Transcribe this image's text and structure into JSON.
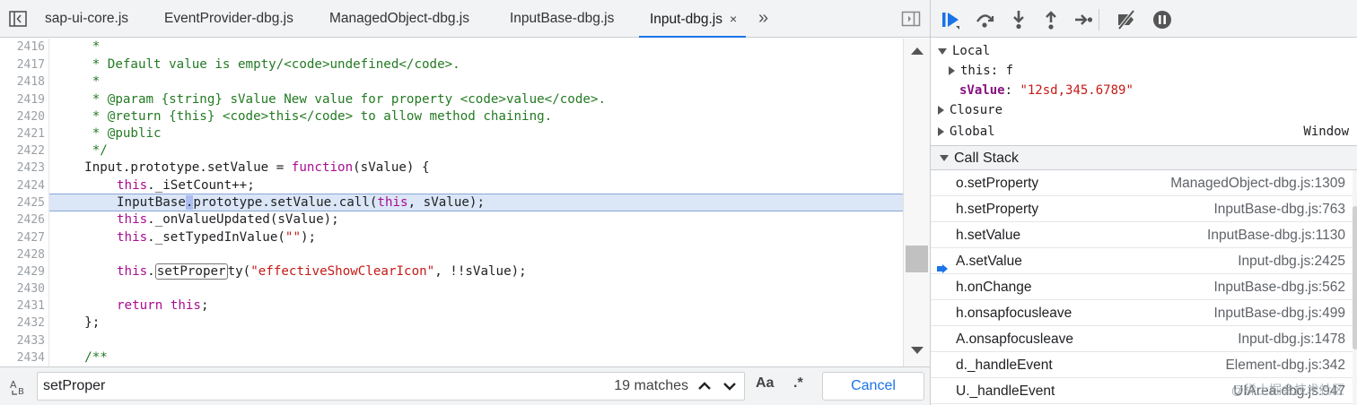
{
  "tabs": [
    {
      "label": "sap-ui-core.js",
      "active": false
    },
    {
      "label": "EventProvider-dbg.js",
      "active": false
    },
    {
      "label": "ManagedObject-dbg.js",
      "active": false
    },
    {
      "label": "InputBase-dbg.js",
      "active": false
    },
    {
      "label": "Input-dbg.js",
      "active": true
    }
  ],
  "tab_close_glyph": "×",
  "tab_more_glyph": "»",
  "code": {
    "lines": [
      {
        "n": "2416"
      },
      {
        "n": "2417"
      },
      {
        "n": "2418"
      },
      {
        "n": "2419"
      },
      {
        "n": "2420"
      },
      {
        "n": "2421"
      },
      {
        "n": "2422"
      },
      {
        "n": "2423"
      },
      {
        "n": "2424"
      },
      {
        "n": "2425"
      },
      {
        "n": "2426"
      },
      {
        "n": "2427"
      },
      {
        "n": "2428"
      },
      {
        "n": "2429"
      },
      {
        "n": "2430"
      },
      {
        "n": "2431"
      },
      {
        "n": "2432"
      },
      {
        "n": "2433"
      },
      {
        "n": "2434"
      }
    ],
    "t2416": "     *",
    "t2417": "     * Default value is empty/<code>undefined</code>.",
    "t2418": "     *",
    "t2419": "     * @param {string} sValue New value for property <code>value</code>.",
    "t2420": "     * @return {this} <code>this</code> to allow method chaining.",
    "t2421": "     * @public",
    "t2422": "     */",
    "t2423a": "    Input.prototype.setValue = ",
    "t2423b": "function",
    "t2423c": "(sValue) {",
    "t2424a": "this",
    "t2424b": "._iSetCount++;",
    "t2425a": "InputBase",
    "t2425b": ".",
    "t2425c": "prototype.setValue.call(",
    "t2425d": "this",
    "t2425e": ", sValue);",
    "t2426a": "this",
    "t2426b": "._onValueUpdated(sValue);",
    "t2427a": "this",
    "t2427b": "._setTypedInValue(",
    "t2427c": "\"\"",
    "t2427d": ");",
    "t2429a": "this",
    "t2429b": ".",
    "t2429c": "setProper",
    "t2429d": "ty(",
    "t2429e": "\"effectiveShowClearIcon\"",
    "t2429f": ", !!sValue);",
    "t2431a": "return",
    "t2431b": " ",
    "t2431c": "this",
    "t2431d": ";",
    "t2432": "    };",
    "t2434": "    /**"
  },
  "search": {
    "value": "setProper",
    "match_count": "19 matches",
    "case_label": "Aa",
    "regex_label": ".*",
    "cancel_label": "Cancel"
  },
  "scope": {
    "local_label": "Local",
    "this_label": "this",
    "this_value": ": f",
    "svalue_label": "sValue",
    "svalue_sep": ": ",
    "svalue_value": "\"12sd,345.6789\"",
    "closure_label": "Closure",
    "global_label": "Global",
    "global_value": "Window"
  },
  "call_stack": {
    "header": "Call Stack",
    "frames": [
      {
        "fn": "o.setProperty",
        "loc": "ManagedObject-dbg.js:1309",
        "current": false
      },
      {
        "fn": "h.setProperty",
        "loc": "InputBase-dbg.js:763",
        "current": false
      },
      {
        "fn": "h.setValue",
        "loc": "InputBase-dbg.js:1130",
        "current": false
      },
      {
        "fn": "A.setValue",
        "loc": "Input-dbg.js:2425",
        "current": true
      },
      {
        "fn": "h.onChange",
        "loc": "InputBase-dbg.js:562",
        "current": false
      },
      {
        "fn": "h.onsapfocusleave",
        "loc": "InputBase-dbg.js:499",
        "current": false
      },
      {
        "fn": "A.onsapfocusleave",
        "loc": "Input-dbg.js:1478",
        "current": false
      },
      {
        "fn": "d._handleEvent",
        "loc": "Element-dbg.js:342",
        "current": false
      },
      {
        "fn": "U._handleEvent",
        "loc": "UIArea-dbg.js:947",
        "current": false
      }
    ]
  },
  "watermark": "@稀土掘金技术社区",
  "colors": {
    "accent": "#1a73e8",
    "comment": "#237a23",
    "keyword": "#aa0d91",
    "string": "#c41a16",
    "highlight": "#dbe6f7"
  },
  "icons": [
    "navigator-toggle-icon",
    "more-tabs-icon",
    "debugger-toggle-icon",
    "regex-toggle-icon",
    "resume-icon",
    "step-over-icon",
    "step-into-icon",
    "step-out-icon",
    "step-icon",
    "deactivate-breakpoints-icon",
    "pause-on-exceptions-icon",
    "current-frame-arrow-icon"
  ]
}
